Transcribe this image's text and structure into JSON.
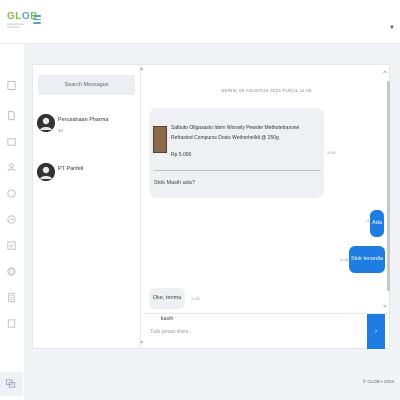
{
  "app": {
    "logo_text": "GL",
    "logo_o": "O",
    "logo_text2": "B",
    "logo_sub": "Global Pharma Commerce",
    "accent": "#1f7de2",
    "brand_green": "#8cbf3f"
  },
  "sidebar": {
    "icons": [
      "dashboard-icon",
      "document-icon",
      "box-icon",
      "users-icon",
      "settings-icon",
      "money-icon",
      "checklist-icon",
      "globe-icon",
      "report-icon",
      "book-icon",
      "chat-icon"
    ]
  },
  "contacts": {
    "search_label": "Search Messages",
    "items": [
      {
        "name": "Perusahaan Pharma",
        "sub": "1h"
      },
      {
        "name": "PT Panfeli",
        "sub": ""
      }
    ]
  },
  "chat": {
    "date": "SENIN, 05 AGUSTUS 2024 PUKUL 11:08",
    "product_title": "Salbuto Ollgasasto Idem Worsely Pewder Methotetraxone Refrasted Compurss Dosis Wetherhelldi @ 250g",
    "product_price": "Rp 5.000",
    "product_question": "Stok Masih ada?",
    "time1": "11:08",
    "reply1": "Ada",
    "reply1_time": "11:08",
    "reply2": "Stok tersedia",
    "reply2_time": "11:09",
    "reply3": "Oke, terima kasih",
    "reply3_time": "11:09",
    "compose_placeholder": "Tulis pesan disini...",
    "send_icon": "›"
  },
  "footer": {
    "text": "© GLOB • 2024"
  }
}
